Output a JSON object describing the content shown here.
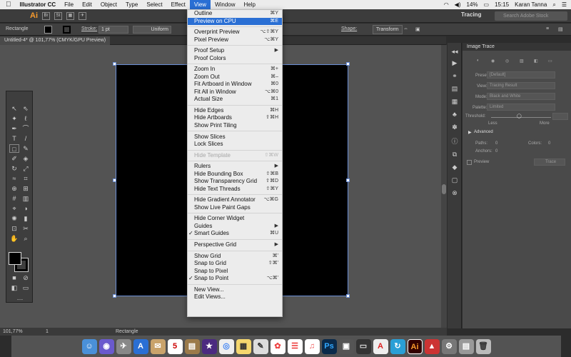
{
  "menubar": {
    "apple": "",
    "app_name": "Illustrator CC",
    "items": [
      "File",
      "Edit",
      "Object",
      "Type",
      "Select",
      "Effect",
      "View",
      "Window",
      "Help"
    ],
    "active": "View",
    "battery": "14%",
    "time": "15:15",
    "user": "Karan Tanna"
  },
  "appbar": {
    "logo": "Ai",
    "workspace": "Tracing",
    "search_placeholder": "Search Adobe Stock"
  },
  "control_bar": {
    "tool_name": "Rectangle",
    "stroke_label": "Stroke:",
    "stroke_value": "1 pt",
    "profile": "Uniform",
    "shape_label": "Shape:",
    "transform_label": "Transform"
  },
  "document": {
    "tab_title": "Untitled-4* @ 101,77% (CMYK/GPU Preview)"
  },
  "status_bar": {
    "zoom": "101,77%",
    "page": "1",
    "tool": "Rectangle"
  },
  "view_menu": {
    "items": [
      {
        "label": "Outline",
        "shortcut": "⌘Y"
      },
      {
        "label": "Preview on CPU",
        "shortcut": "⌘E",
        "selected": true
      },
      {
        "sep": true
      },
      {
        "label": "Overprint Preview",
        "shortcut": "⌥⇧⌘Y"
      },
      {
        "label": "Pixel Preview",
        "shortcut": "⌥⌘Y"
      },
      {
        "sep": true
      },
      {
        "label": "Proof Setup",
        "shortcut": "▶"
      },
      {
        "label": "Proof Colors",
        "shortcut": ""
      },
      {
        "sep": true
      },
      {
        "label": "Zoom In",
        "shortcut": "⌘+"
      },
      {
        "label": "Zoom Out",
        "shortcut": "⌘–"
      },
      {
        "label": "Fit Artboard in Window",
        "shortcut": "⌘0"
      },
      {
        "label": "Fit All in Window",
        "shortcut": "⌥⌘0"
      },
      {
        "label": "Actual Size",
        "shortcut": "⌘1"
      },
      {
        "sep": true
      },
      {
        "label": "Hide Edges",
        "shortcut": "⌘H"
      },
      {
        "label": "Hide Artboards",
        "shortcut": "⇧⌘H"
      },
      {
        "label": "Show Print Tiling",
        "shortcut": ""
      },
      {
        "sep": true
      },
      {
        "label": "Show Slices",
        "shortcut": ""
      },
      {
        "label": "Lock Slices",
        "shortcut": ""
      },
      {
        "sep": true
      },
      {
        "label": "Hide Template",
        "shortcut": "⇧⌘W",
        "disabled": true
      },
      {
        "sep": true
      },
      {
        "label": "Rulers",
        "shortcut": "▶"
      },
      {
        "label": "Hide Bounding Box",
        "shortcut": "⇧⌘B"
      },
      {
        "label": "Show Transparency Grid",
        "shortcut": "⇧⌘D"
      },
      {
        "label": "Hide Text Threads",
        "shortcut": "⇧⌘Y"
      },
      {
        "sep": true
      },
      {
        "label": "Hide Gradient Annotator",
        "shortcut": "⌥⌘G"
      },
      {
        "label": "Show Live Paint Gaps",
        "shortcut": ""
      },
      {
        "sep": true
      },
      {
        "label": "Hide Corner Widget",
        "shortcut": ""
      },
      {
        "label": "Guides",
        "shortcut": "▶"
      },
      {
        "label": "Smart Guides",
        "shortcut": "⌘U",
        "checked": true
      },
      {
        "sep": true
      },
      {
        "label": "Perspective Grid",
        "shortcut": "▶"
      },
      {
        "sep": true
      },
      {
        "label": "Show Grid",
        "shortcut": "⌘'"
      },
      {
        "label": "Snap to Grid",
        "shortcut": "⇧⌘'"
      },
      {
        "label": "Snap to Pixel",
        "shortcut": ""
      },
      {
        "label": "Snap to Point",
        "shortcut": "⌥⌘'",
        "checked": true
      },
      {
        "sep": true
      },
      {
        "label": "New View...",
        "shortcut": ""
      },
      {
        "label": "Edit Views...",
        "shortcut": ""
      }
    ]
  },
  "image_trace": {
    "title": "Image Trace",
    "preset_label": "Preset:",
    "preset_value": "[Default]",
    "view_label": "View:",
    "view_value": "Tracing Result",
    "mode_label": "Mode:",
    "mode_value": "Black and White",
    "palette_label": "Palette:",
    "palette_value": "Limited",
    "threshold_label": "Threshold:",
    "threshold_value": "",
    "less_label": "Less",
    "more_label": "More",
    "advanced_label": "Advanced",
    "paths_label": "Paths:",
    "paths_value": "0",
    "colors_label": "Colors:",
    "colors_value": "0",
    "anchors_label": "Anchors:",
    "anchors_value": "0",
    "preview_label": "Preview",
    "trace_button": "Trace"
  },
  "colors": {
    "accent": "#2a6fd4",
    "artboard": "#000000",
    "canvas": "#535353"
  }
}
